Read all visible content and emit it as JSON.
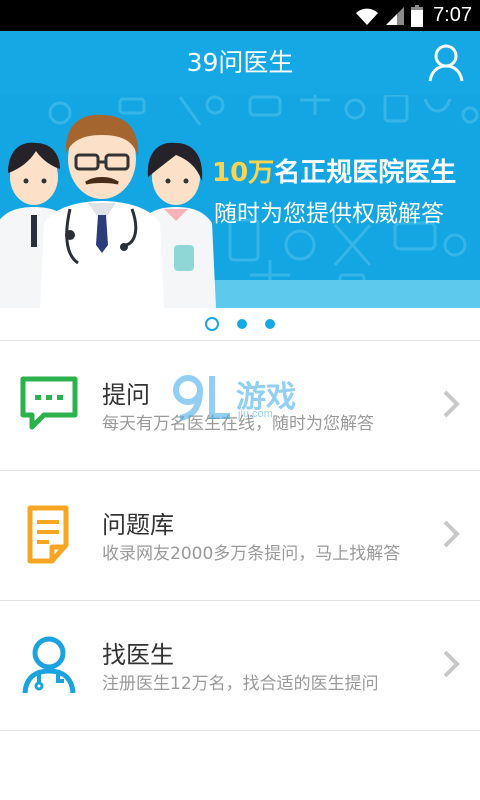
{
  "status_bar": {
    "time": "7:07",
    "icons": [
      "wifi-icon",
      "signal-icon",
      "battery-icon"
    ]
  },
  "header": {
    "title": "39问医生",
    "user_icon": "user-icon"
  },
  "banner": {
    "highlight": "10万",
    "line1_rest": "名正规医院医生",
    "line2": "随时为您提供权威解答",
    "pages": 3,
    "active_page": 1
  },
  "menu": [
    {
      "icon": "chat-icon",
      "title": "提问",
      "desc": "每天有万名医生在线，随时为您解答"
    },
    {
      "icon": "document-icon",
      "title": "问题库",
      "desc": "收录网友2000多万条提问，马上找解答"
    },
    {
      "icon": "doctor-icon",
      "title": "找医生",
      "desc": "注册医生12万名，找合适的医生提问"
    }
  ],
  "watermark": {
    "text": "游戏",
    "sub": "jiu.com",
    "logo": "9L"
  },
  "colors": {
    "primary": "#16a7e5",
    "highlight": "#ffd34e",
    "chat": "#2bb24c",
    "doc": "#f6a623",
    "doctor": "#1aa3de"
  }
}
